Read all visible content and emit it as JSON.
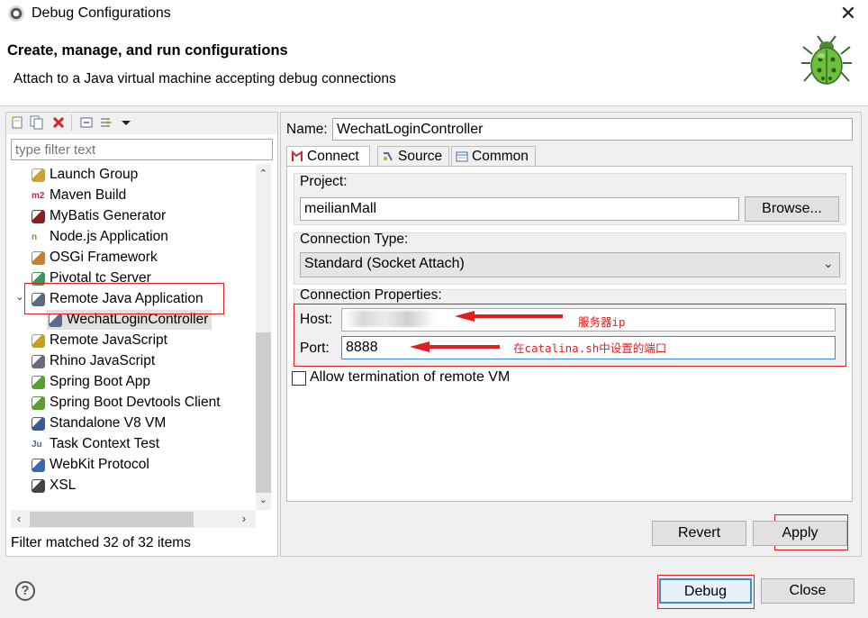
{
  "window": {
    "title": "Debug Configurations",
    "close_glyph": "✕"
  },
  "header": {
    "title": "Create, manage, and run configurations",
    "subtitle": "Attach to a Java virtual machine accepting debug connections",
    "icon": "bug-icon"
  },
  "left": {
    "toolbar": [
      {
        "name": "new-config-icon"
      },
      {
        "name": "duplicate-config-icon"
      },
      {
        "name": "delete-config-icon"
      },
      {
        "name": "collapse-all-icon"
      },
      {
        "name": "filter-config-icon"
      },
      {
        "name": "view-menu-icon"
      }
    ],
    "filter_placeholder": "type filter text",
    "tree": [
      {
        "label": "Launch Group",
        "icon": "launch-group-icon"
      },
      {
        "label": "Maven Build",
        "icon": "maven-icon",
        "icon_text": "m2"
      },
      {
        "label": "MyBatis Generator",
        "icon": "mybatis-icon"
      },
      {
        "label": "Node.js Application",
        "icon": "nodejs-icon",
        "icon_text": "n"
      },
      {
        "label": "OSGi Framework",
        "icon": "osgi-icon"
      },
      {
        "label": "Pivotal tc Server",
        "icon": "pivotal-icon"
      },
      {
        "label": "Remote Java Application",
        "icon": "remote-java-icon",
        "expanded": true
      },
      {
        "label": "WechatLoginController",
        "icon": "remote-java-config-icon",
        "child": true,
        "selected": true
      },
      {
        "label": "Remote JavaScript",
        "icon": "remote-js-icon"
      },
      {
        "label": "Rhino JavaScript",
        "icon": "rhino-icon"
      },
      {
        "label": "Spring Boot App",
        "icon": "spring-boot-icon"
      },
      {
        "label": "Spring Boot Devtools Client",
        "icon": "spring-devtools-icon"
      },
      {
        "label": "Standalone V8 VM",
        "icon": "v8-icon"
      },
      {
        "label": "Task Context Test",
        "icon": "task-context-icon",
        "icon_text": "Ju"
      },
      {
        "label": "WebKit Protocol",
        "icon": "webkit-icon"
      },
      {
        "label": "XSL",
        "icon": "xsl-icon"
      }
    ],
    "status": "Filter matched 32 of 32 items"
  },
  "right": {
    "name_label": "Name:",
    "name_value": "WechatLoginController",
    "tabs": [
      {
        "label": "Connect",
        "icon": "connect-tab-icon",
        "active": true
      },
      {
        "label": "Source",
        "icon": "source-tab-icon"
      },
      {
        "label": "Common",
        "icon": "common-tab-icon"
      }
    ],
    "project": {
      "label": "Project:",
      "value": "meilianMall",
      "browse": "Browse..."
    },
    "connection_type": {
      "label": "Connection Type:",
      "value": "Standard (Socket Attach)"
    },
    "connection_properties": {
      "label": "Connection Properties:",
      "host_label": "Host:",
      "host_value": "",
      "port_label": "Port:",
      "port_value": "8888"
    },
    "allow_termination": {
      "label": "Allow termination of remote VM",
      "checked": false
    },
    "revert": "Revert",
    "apply": "Apply"
  },
  "annotations": {
    "host_note": "服务器ip",
    "port_note": "在catalina.sh中设置的端口"
  },
  "footer": {
    "debug": "Debug",
    "close": "Close",
    "help": "?"
  },
  "colors": {
    "annotation_red": "#e02020",
    "selection": "#e0e0e0",
    "panel_bg": "#f0f0f0"
  }
}
